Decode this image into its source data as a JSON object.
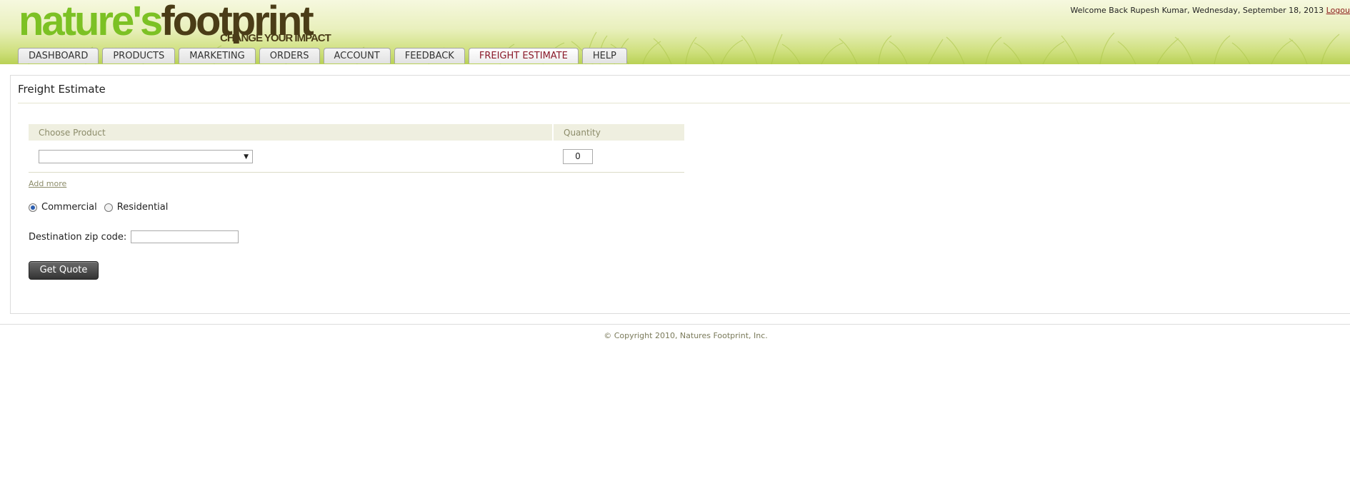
{
  "brand": {
    "name_part1": "nature's",
    "name_part2": "footprint",
    "tagline": "CHANGE YOUR IMPACT",
    "colors": {
      "green": "#7cc124",
      "brown": "#4a3c17"
    }
  },
  "header": {
    "welcome_text": "Welcome Back Rupesh Kumar, Wednesday, September 18, 2013",
    "logout_label": "Logou"
  },
  "nav": {
    "tabs": [
      {
        "label": "DASHBOARD"
      },
      {
        "label": "PRODUCTS"
      },
      {
        "label": "MARKETING"
      },
      {
        "label": "ORDERS"
      },
      {
        "label": "ACCOUNT"
      },
      {
        "label": "FEEDBACK"
      },
      {
        "label": "FREIGHT ESTIMATE",
        "active": true
      },
      {
        "label": "HELP"
      }
    ]
  },
  "freight": {
    "title": "Freight Estimate",
    "table": {
      "col_product": "Choose Product",
      "col_quantity": "Quantity",
      "product_selected": "",
      "quantity_value": "0"
    },
    "add_more_label": "Add more",
    "delivery_options": [
      {
        "label": "Commercial",
        "checked": true
      },
      {
        "label": "Residential",
        "checked": false
      }
    ],
    "zip_label": "Destination zip code:",
    "zip_value": "",
    "submit_label": "Get Quote"
  },
  "footer": {
    "copyright": "© Copyright 2010, Natures Footprint, Inc."
  }
}
